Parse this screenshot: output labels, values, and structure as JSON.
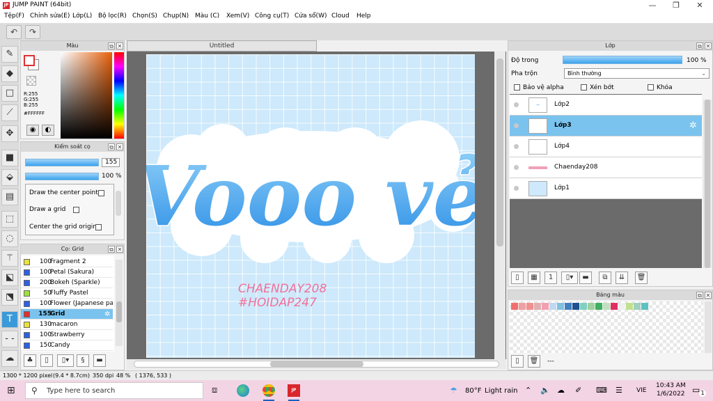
{
  "window": {
    "title": "JUMP PAINT (64bit)",
    "min": "—",
    "restore": "❐",
    "close": "✕"
  },
  "menu": [
    "Tệp(F)",
    "Chỉnh sửa(E)",
    "Lớp(L)",
    "Bộ lọc(R)",
    "Chọn(S)",
    "Chụp(N)",
    "Màu (C)",
    "Xem(V)",
    "Công cụ(T)",
    "Cửa sổ(W)",
    "Cloud",
    "Help"
  ],
  "color_panel": {
    "title": "Màu",
    "r": "R:255",
    "g": "G:255",
    "b": "B:255",
    "hex": "#FFFFFF"
  },
  "brush_panel": {
    "title": "Kiểm soát cọ",
    "size": "155",
    "opacity": "100 %",
    "options": [
      "Draw the center point",
      "Draw a grid",
      "Center the grid origin"
    ]
  },
  "brush_list": {
    "title": "Cọ: Grid",
    "items": [
      {
        "size": "100",
        "name": "Fragment 2",
        "color": "#e8e040"
      },
      {
        "size": "100",
        "name": "Petal (Sakura)",
        "color": "#3060e0"
      },
      {
        "size": "200",
        "name": "Bokeh (Sparkle)",
        "color": "#3060e0"
      },
      {
        "size": "50",
        "name": "Fluffy Pastel",
        "color": "#a0e040"
      },
      {
        "size": "100",
        "name": "Flower (Japanese patt",
        "color": "#3060e0"
      },
      {
        "size": "155",
        "name": "Grid",
        "color": "#e03030",
        "selected": true
      },
      {
        "size": "130",
        "name": "macaron",
        "color": "#e8e040"
      },
      {
        "size": "100",
        "name": "Strawberry",
        "color": "#3060e0"
      },
      {
        "size": "150",
        "name": "Candy",
        "color": "#3060e0"
      }
    ]
  },
  "document": {
    "tab": "Untitled"
  },
  "artwork": {
    "main": "Vooo vẻ",
    "line1": "CHAENDAY208",
    "line2": "#HOIDAP247"
  },
  "layer_panel": {
    "title": "Lớp",
    "opacity_label": "Độ trong",
    "opacity_value": "100 %",
    "blend_label": "Pha trộn",
    "blend_value": "Bình thường",
    "protect_alpha": "Bảo vệ alpha",
    "clipping": "Xén bớt",
    "lock": "Khóa",
    "layers": [
      {
        "name": "Lớp2",
        "selected": false
      },
      {
        "name": "Lớp3",
        "selected": true
      },
      {
        "name": "Lớp4",
        "selected": false
      },
      {
        "name": "Chaenday208",
        "selected": false
      },
      {
        "name": "Lớp1",
        "selected": false
      }
    ]
  },
  "palette": {
    "title": "Bảng màu",
    "more": "---",
    "swatches": [
      "#f07070",
      "#f0a0a0",
      "#f09090",
      "#e0b0b0",
      "#f0a0b0",
      "#c0d8f0",
      "#80c0e0",
      "#4080c0",
      "#205090",
      "#80d0c0",
      "#a0d0a0",
      "#40b060",
      "#c0e0c0",
      "#e03060",
      "#f0f0f0",
      "#c0e090",
      "#a0d0c0",
      "#60c0c0"
    ]
  },
  "status": {
    "dims": "1300 * 1200 pixel",
    "size": "(9.4 * 8.7cm)",
    "dpi": "350 dpi",
    "zoom": "48 %",
    "coords": "( 1376, 533 )"
  },
  "taskbar": {
    "search": "Type here to search",
    "weather_temp": "80°F",
    "weather_text": "Light rain",
    "lang": "VIE",
    "time": "10:43 AM",
    "date": "1/6/2022",
    "notif": "1"
  }
}
